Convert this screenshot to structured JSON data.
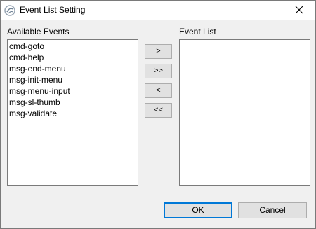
{
  "window": {
    "title": "Event List Setting"
  },
  "available": {
    "label": "Available Events",
    "items": [
      "cmd-goto",
      "cmd-help",
      "msg-end-menu",
      "msg-init-menu",
      "msg-menu-input",
      "msg-sl-thumb",
      "msg-validate"
    ]
  },
  "selected": {
    "label": "Event List",
    "items": []
  },
  "move_buttons": {
    "add": ">",
    "add_all": ">>",
    "remove": "<",
    "remove_all": "<<"
  },
  "footer": {
    "ok": "OK",
    "cancel": "Cancel"
  },
  "icons": {
    "app": "app-logo-icon",
    "close": "close-icon"
  },
  "colors": {
    "accent": "#0078d7",
    "dialog_bg": "#f0f0f0",
    "button_bg": "#e1e1e1"
  }
}
